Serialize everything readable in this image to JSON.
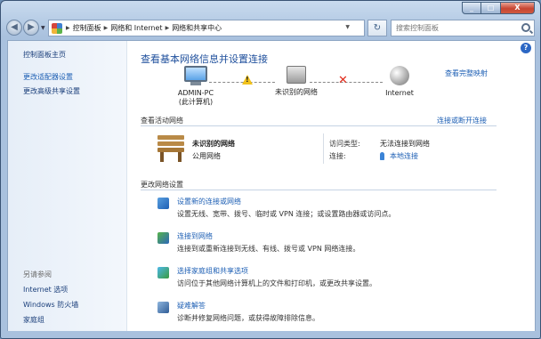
{
  "window": {
    "minimize": "_",
    "maximize": "□",
    "close": "X"
  },
  "nav": {
    "back": "◀",
    "forward": "▶",
    "refresh": "↻"
  },
  "breadcrumb": [
    "控制面板",
    "网络和 Internet",
    "网络和共享中心"
  ],
  "search": {
    "placeholder": "搜索控制面板"
  },
  "sidebar": {
    "home": "控制面板主页",
    "links": [
      "更改适配器设置",
      "更改高级共享设置"
    ],
    "see_also_heading": "另请参阅",
    "see_also": [
      "Internet 选项",
      "Windows 防火墙",
      "家庭组"
    ]
  },
  "main": {
    "title": "查看基本网络信息并设置连接",
    "full_map_link": "查看完整映射",
    "map": {
      "computer_name": "ADMIN-PC",
      "computer_sub": "(此计算机)",
      "unknown_network": "未识别的网络",
      "internet": "Internet"
    },
    "active_heading": "查看活动网络",
    "connect_link": "连接或断开连接",
    "active": {
      "name": "未识别的网络",
      "type": "公用网络",
      "access_label": "访问类型:",
      "access_value": "无法连接到网络",
      "conn_label": "连接:",
      "conn_value": "本地连接"
    },
    "change_heading": "更改网络设置",
    "tasks": [
      {
        "title": "设置新的连接或网络",
        "desc": "设置无线、宽带、拨号、临时或 VPN 连接；或设置路由器或访问点。"
      },
      {
        "title": "连接到网络",
        "desc": "连接到或重新连接到无线、有线、拨号或 VPN 网络连接。"
      },
      {
        "title": "选择家庭组和共享选项",
        "desc": "访问位于其他网络计算机上的文件和打印机，或更改共享设置。"
      },
      {
        "title": "疑难解答",
        "desc": "诊断并修复网络问题，或获得故障排除信息。"
      }
    ]
  },
  "help": "?"
}
